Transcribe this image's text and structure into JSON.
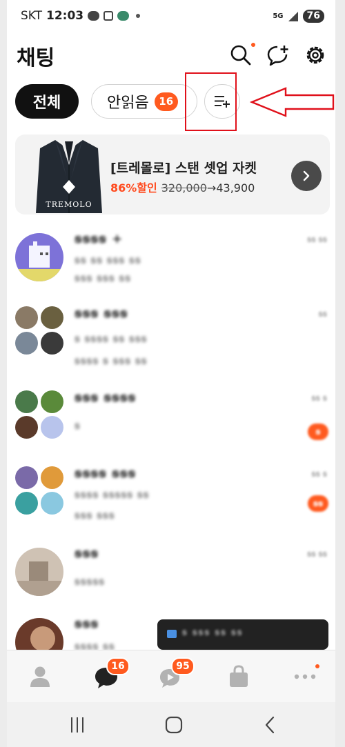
{
  "status_bar": {
    "carrier": "SKT",
    "time": "12:03",
    "network": "5G",
    "battery": "76"
  },
  "header": {
    "title": "채팅"
  },
  "filters": [
    {
      "label": "전체"
    },
    {
      "label": "안읽음",
      "count": "16"
    }
  ],
  "ad": {
    "title": "[트레몰로] 스탠 셋업 자켓",
    "discount": "86%할인",
    "original_price": "320,000",
    "sale_price": "→43,900",
    "brand": "TREMOLO"
  },
  "chats": [
    {
      "name": "ꞩꞩꞩꞩ +",
      "preview": [
        "ꞩꞩ ꞩꞩ ꞩꞩꞩ ꞩꞩ",
        "ꞩꞩꞩ ꞩꞩꞩ ꞩꞩ"
      ],
      "time": "ꞩꞩ ꞩꞩ"
    },
    {
      "name": "ꞩꞩꞩ ꞩꞩꞩ",
      "preview": [
        "ꞩ ꞩꞩꞩꞩ ꞩꞩ ꞩꞩꞩ",
        "ꞩꞩꞩꞩ ꞩ ꞩꞩꞩ ꞩꞩ"
      ],
      "time": "ꞩꞩ"
    },
    {
      "name": "ꞩꞩꞩ ꞩꞩꞩꞩ",
      "preview": [
        "ꞩ"
      ],
      "time": "ꞩꞩ ꞩ",
      "unread": "ꞩ"
    },
    {
      "name": "ꞩꞩꞩꞩ ꞩꞩꞩ",
      "preview": [
        "ꞩꞩꞩꞩ ꞩꞩꞩꞩꞩ ꞩꞩ",
        "ꞩꞩꞩ ꞩꞩꞩ"
      ],
      "time": "ꞩꞩ ꞩ",
      "unread": "ꞩꞩ"
    },
    {
      "name": "ꞩꞩꞩ",
      "preview": [
        "ꞩꞩꞩꞩꞩ"
      ],
      "time": "ꞩꞩ ꞩꞩ"
    },
    {
      "name": "ꞩꞩꞩ",
      "preview": [
        "ꞩꞩꞩꞩ ꞩꞩ"
      ],
      "time": ""
    }
  ],
  "toast": {
    "text": "ꞩ ꞩꞩꞩ ꞩꞩ ꞩꞩ"
  },
  "tabs": [
    {
      "name": "friends"
    },
    {
      "name": "chats",
      "badge": "16"
    },
    {
      "name": "openchat",
      "badge": "95"
    },
    {
      "name": "shopping"
    },
    {
      "name": "more"
    }
  ],
  "colors": {
    "accent": "#ff5a1f",
    "annotation": "#e0101a"
  }
}
